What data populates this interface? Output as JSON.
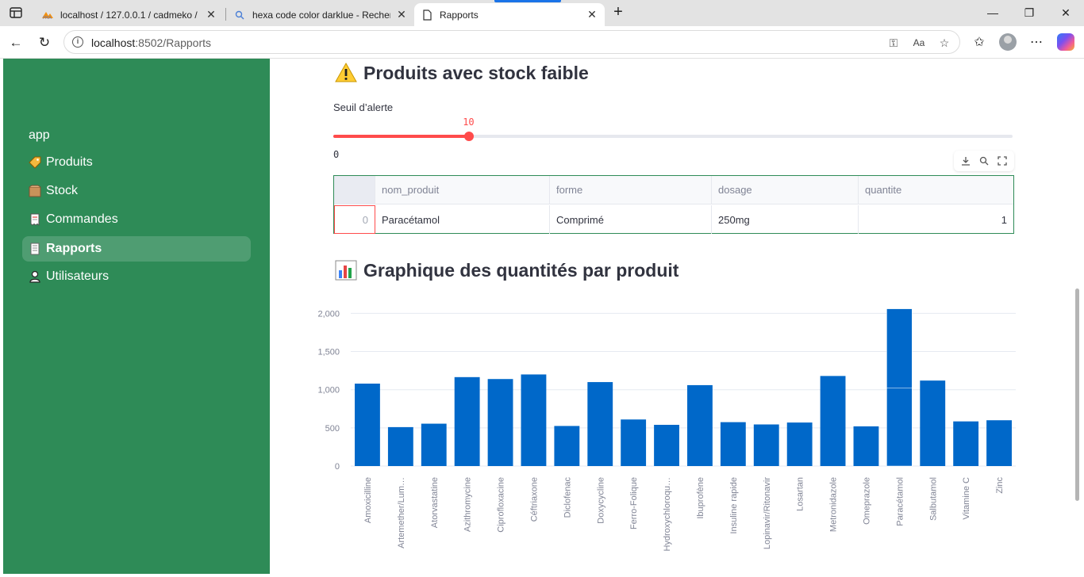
{
  "browser": {
    "tabs": [
      {
        "title": "localhost / 127.0.0.1 / cadmeko / ",
        "icon": "phpmyadmin-icon",
        "active": false
      },
      {
        "title": "hexa code color darklue - Recherc",
        "icon": "search-icon",
        "active": false
      },
      {
        "title": "Rapports",
        "icon": "page-icon",
        "active": true
      }
    ],
    "url_host": "localhost",
    "url_path": ":8502/Rapports"
  },
  "sidebar": {
    "app_label": "app",
    "items": [
      {
        "label": "Produits",
        "icon": "label-tag-icon",
        "active": false
      },
      {
        "label": "Stock",
        "icon": "package-icon",
        "active": false
      },
      {
        "label": "Commandes",
        "icon": "receipt-icon",
        "active": false
      },
      {
        "label": "Rapports",
        "icon": "report-icon",
        "active": true
      },
      {
        "label": "Utilisateurs",
        "icon": "user-icon",
        "active": false
      }
    ]
  },
  "main": {
    "low_stock_title": "Produits avec stock faible",
    "low_stock_icon": "warning-icon",
    "slider": {
      "label": "Seuil d’alerte",
      "value": 10,
      "min": 0,
      "max": 50,
      "min_label": "0",
      "value_label": "10",
      "color": "#ff4b4b"
    },
    "table": {
      "columns": [
        "",
        "nom_produit",
        "forme",
        "dosage",
        "quantite"
      ],
      "rows": [
        {
          "index": "0",
          "nom_produit": "Paracétamol",
          "forme": "Comprimé",
          "dosage": "250mg",
          "quantite": "1"
        }
      ]
    },
    "chart_title": "Graphique des quantités par produit",
    "chart_icon": "bar-chart-icon"
  },
  "colors": {
    "sidebar": "#2e8b57",
    "accent": "#ff4b4b",
    "bar": "#0068c9"
  },
  "chart_data": {
    "type": "bar",
    "categories": [
      "Amoxicilline",
      "Artemether/Lum…",
      "Atorvastatine",
      "Azithromycine",
      "Ciprofloxacine",
      "Céftriaxone",
      "Diclofenac",
      "Doxycycline",
      "Ferro-Folique",
      "Hydroxychloroqu…",
      "Ibuprofène",
      "Insuline rapide",
      "Lopinavir/Ritonavir",
      "Losartan",
      "Metronidazole",
      "Omeprazole",
      "Paracétamol",
      "Salbutamol",
      "Vitamine C",
      "Zinc"
    ],
    "values": [
      1080,
      510,
      555,
      1165,
      1140,
      1200,
      525,
      1100,
      610,
      540,
      1060,
      575,
      545,
      570,
      1180,
      520,
      2060,
      1120,
      585,
      600
    ],
    "stacked_segments": {
      "Paracétamol": [
        1020,
        1040
      ]
    },
    "yticks": [
      0,
      500,
      1000,
      1500,
      2000
    ],
    "ytick_labels": [
      "0",
      "500",
      "1,000",
      "1,500",
      "2,000"
    ],
    "ylim": [
      0,
      2160
    ],
    "xlabel": "",
    "ylabel": "",
    "grid": true
  }
}
